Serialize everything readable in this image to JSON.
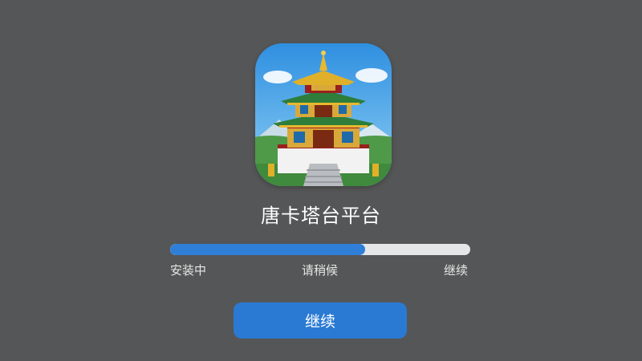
{
  "app": {
    "name": "唐卡塔台平台",
    "icon": "temple-app-icon"
  },
  "progress": {
    "value": 0.65,
    "fill_color": "#2f7fd9",
    "track_color": "#e4e6e8",
    "steps": [
      "安装中",
      "请稍候",
      "继续"
    ]
  },
  "actions": {
    "continue_label": "继续",
    "continue_color": "#2a7ad4"
  }
}
